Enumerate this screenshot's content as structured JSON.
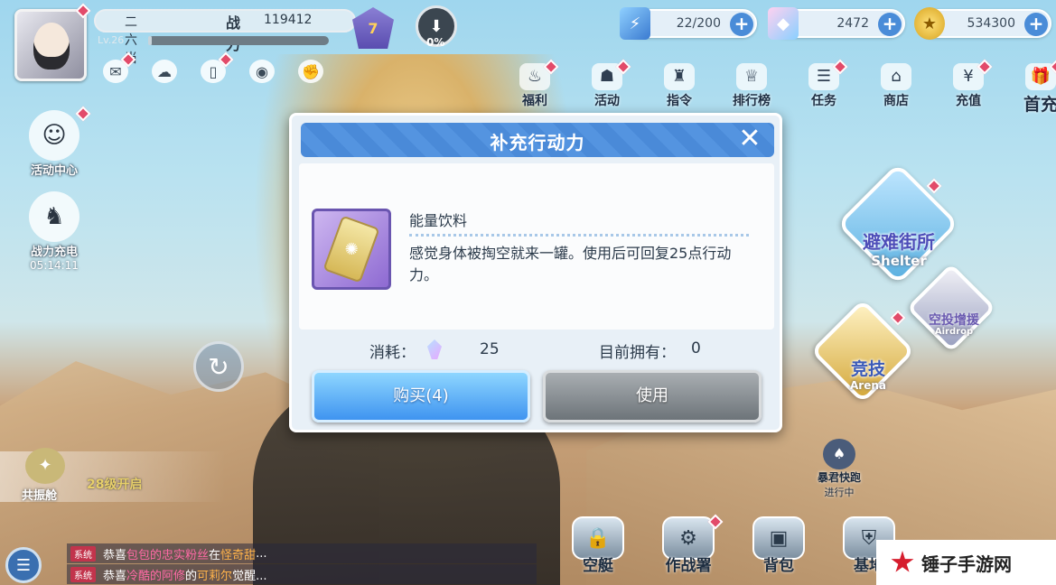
{
  "player": {
    "name": "二六当",
    "power_label": "战力",
    "power_value": "119412",
    "level": "Lv.26",
    "exp_fraction": 0.02,
    "rank": "7",
    "download_percent": "0%"
  },
  "resources": {
    "stamina": "22/200",
    "gems": "2472",
    "gold": "534300"
  },
  "top_menu": [
    "福利",
    "活动",
    "指令",
    "排行榜",
    "任务",
    "商店",
    "充值",
    "首充"
  ],
  "left_panel": {
    "event_center": "活动中心",
    "power_charge": "战力充电",
    "power_charge_timer": "05:14:11",
    "resonance": "共振舱",
    "resonance_lock": "28级开启"
  },
  "chat": [
    {
      "tag": "系统",
      "prefix": "恭喜",
      "name": "包包的忠实粉丝",
      "mid": "在",
      "highlight": "怪奇甜",
      "suffix": "..."
    },
    {
      "tag": "系统",
      "prefix": "恭喜",
      "name": "冷酷的阿修",
      "mid": "的",
      "highlight": "可莉尔",
      "suffix": "觉醒..."
    }
  ],
  "bottom_nav": [
    "空艇",
    "作战署",
    "背包",
    "基地"
  ],
  "map": {
    "shelter_cn": "避难街所",
    "shelter_en": "Shelter",
    "arena_cn": "竞技",
    "arena_en": "Arena",
    "airdrop_cn": "空投增援",
    "airdrop_en": "Airdrop",
    "boss_name": "暴君快跑",
    "boss_status": "进行中"
  },
  "dialog": {
    "title": "补充行动力",
    "item_name": "能量饮料",
    "item_desc": "感觉身体被掏空就来一罐。使用后可回复25点行动力。",
    "cost_label": "消耗：",
    "cost_value": "25",
    "own_label": "目前拥有：",
    "own_value": "0",
    "buy_label": "购买(4)",
    "use_label": "使用"
  },
  "watermark": "锤子手游网",
  "colors": {
    "dialog_header": "#4a8ad8",
    "buy_button": "#3f94f0",
    "use_button": "#6d7479",
    "notify_dot": "#e24b6a"
  },
  "icons": {
    "close": "close-icon",
    "gem": "gem-icon",
    "gold": "coin-icon",
    "stamina": "energy-icon"
  }
}
